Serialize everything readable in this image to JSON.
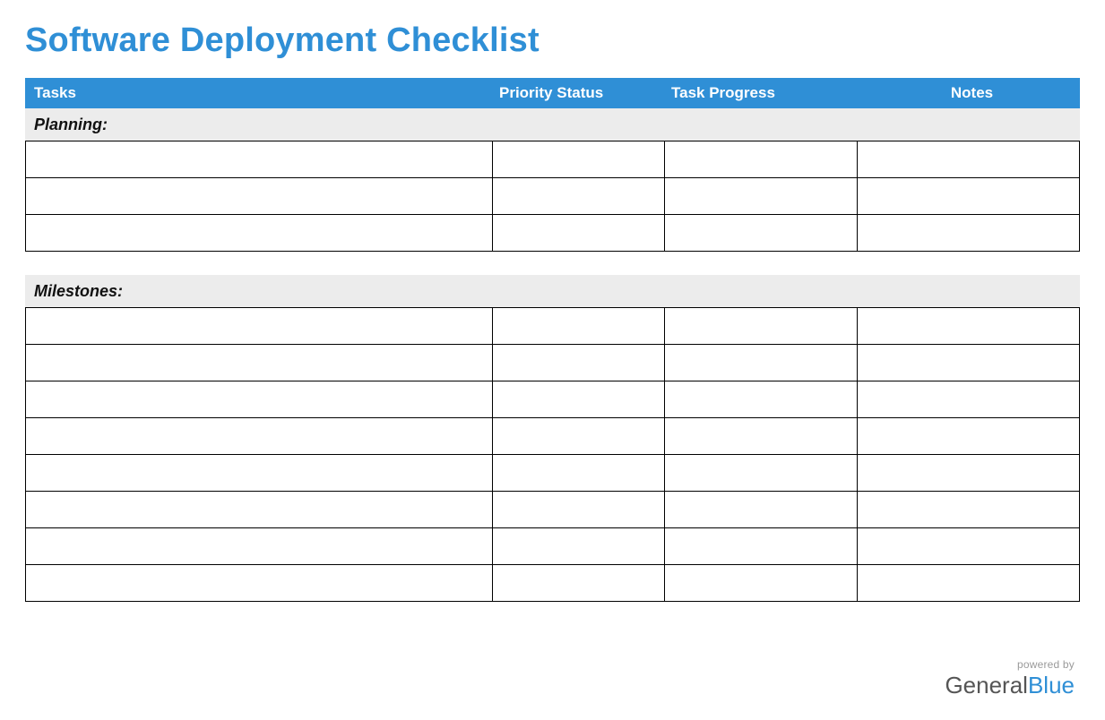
{
  "title": "Software Deployment Checklist",
  "columns": {
    "tasks": "Tasks",
    "priority": "Priority Status",
    "progress": "Task Progress",
    "notes": "Notes"
  },
  "sections": [
    {
      "label": "Planning:",
      "rows": [
        {
          "tasks": "",
          "priority": "",
          "progress": "",
          "notes": ""
        },
        {
          "tasks": "",
          "priority": "",
          "progress": "",
          "notes": ""
        },
        {
          "tasks": "",
          "priority": "",
          "progress": "",
          "notes": ""
        }
      ]
    },
    {
      "label": "Milestones:",
      "rows": [
        {
          "tasks": "",
          "priority": "",
          "progress": "",
          "notes": ""
        },
        {
          "tasks": "",
          "priority": "",
          "progress": "",
          "notes": ""
        },
        {
          "tasks": "",
          "priority": "",
          "progress": "",
          "notes": ""
        },
        {
          "tasks": "",
          "priority": "",
          "progress": "",
          "notes": ""
        },
        {
          "tasks": "",
          "priority": "",
          "progress": "",
          "notes": ""
        },
        {
          "tasks": "",
          "priority": "",
          "progress": "",
          "notes": ""
        },
        {
          "tasks": "",
          "priority": "",
          "progress": "",
          "notes": ""
        },
        {
          "tasks": "",
          "priority": "",
          "progress": "",
          "notes": ""
        }
      ]
    }
  ],
  "footer": {
    "powered": "powered by",
    "brand_main": "General",
    "brand_accent": "Blue"
  },
  "colors": {
    "accent": "#2f8fd6",
    "section_bg": "#ececec"
  }
}
